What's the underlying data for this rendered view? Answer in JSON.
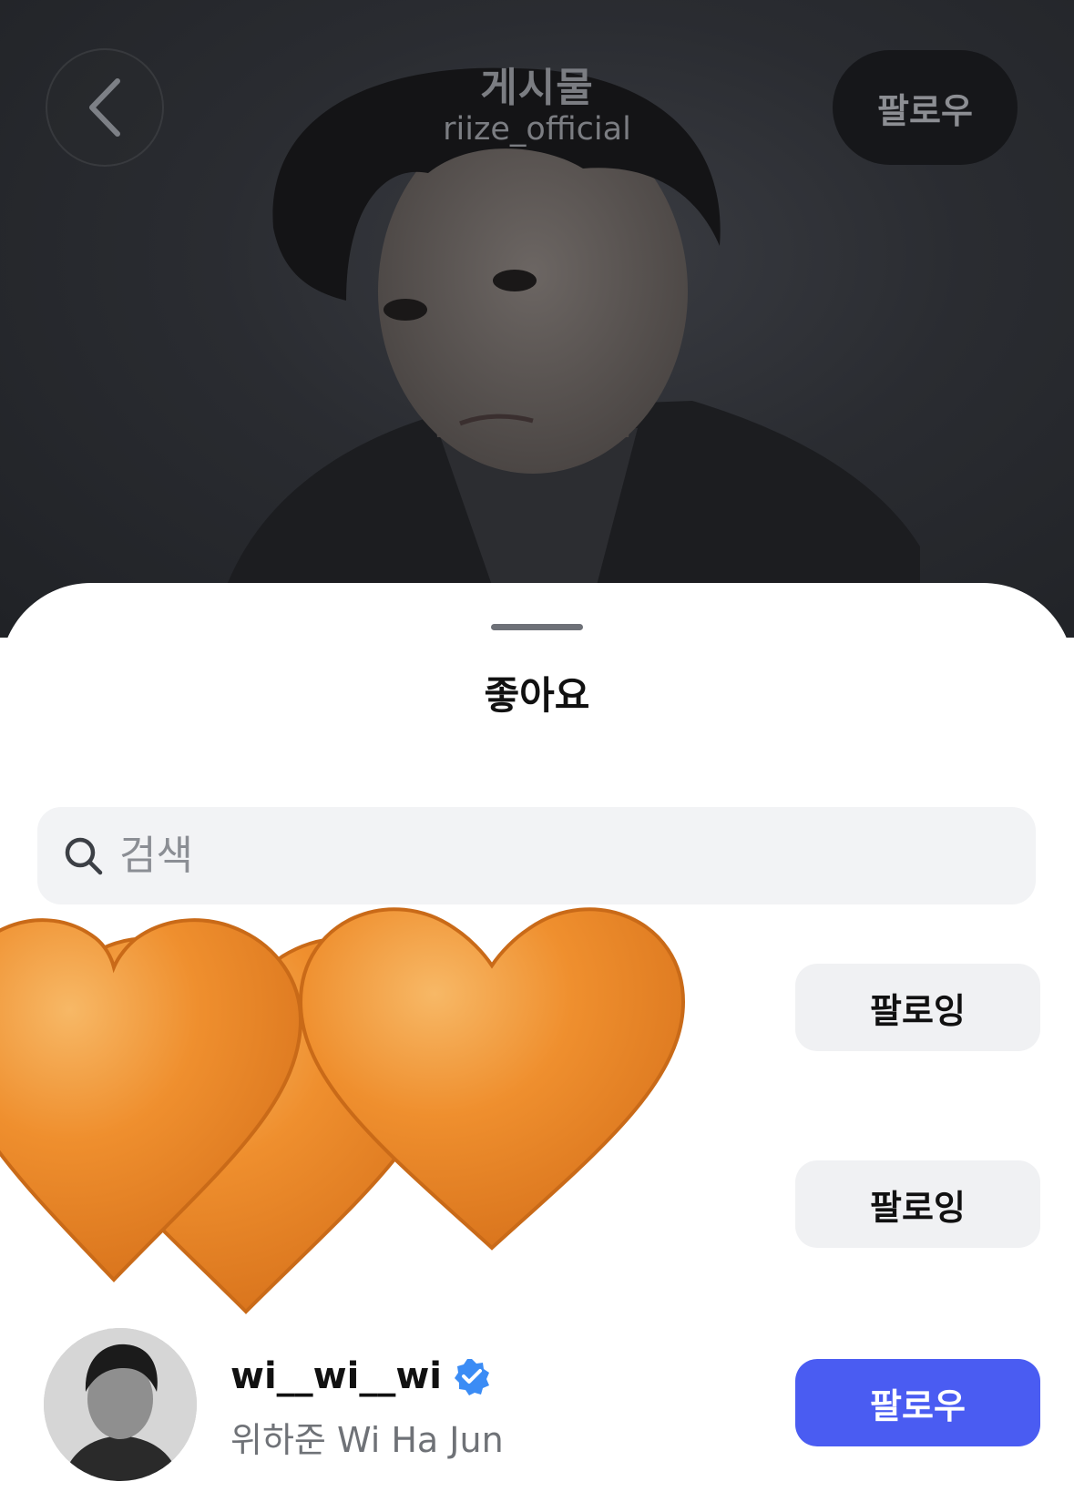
{
  "header": {
    "title": "게시물",
    "subtitle": "riize_official",
    "follow_label": "팔로우"
  },
  "sheet": {
    "title": "좋아요",
    "search_placeholder": "검색"
  },
  "likers": [
    {
      "button_label": "팔로잉",
      "state": "following"
    },
    {
      "button_label": "팔로잉",
      "state": "following"
    },
    {
      "username": "wi__wi__wi",
      "verified": true,
      "full_name": "위하준 Wi Ha Jun",
      "button_label": "팔로우",
      "state": "not-following"
    }
  ],
  "colors": {
    "accent": "#4a5cf2",
    "heart": "#ef8a2a",
    "verified": "#3b8cf5"
  },
  "overlay": {
    "icon": "orange-heart-emoji",
    "count": 3
  }
}
